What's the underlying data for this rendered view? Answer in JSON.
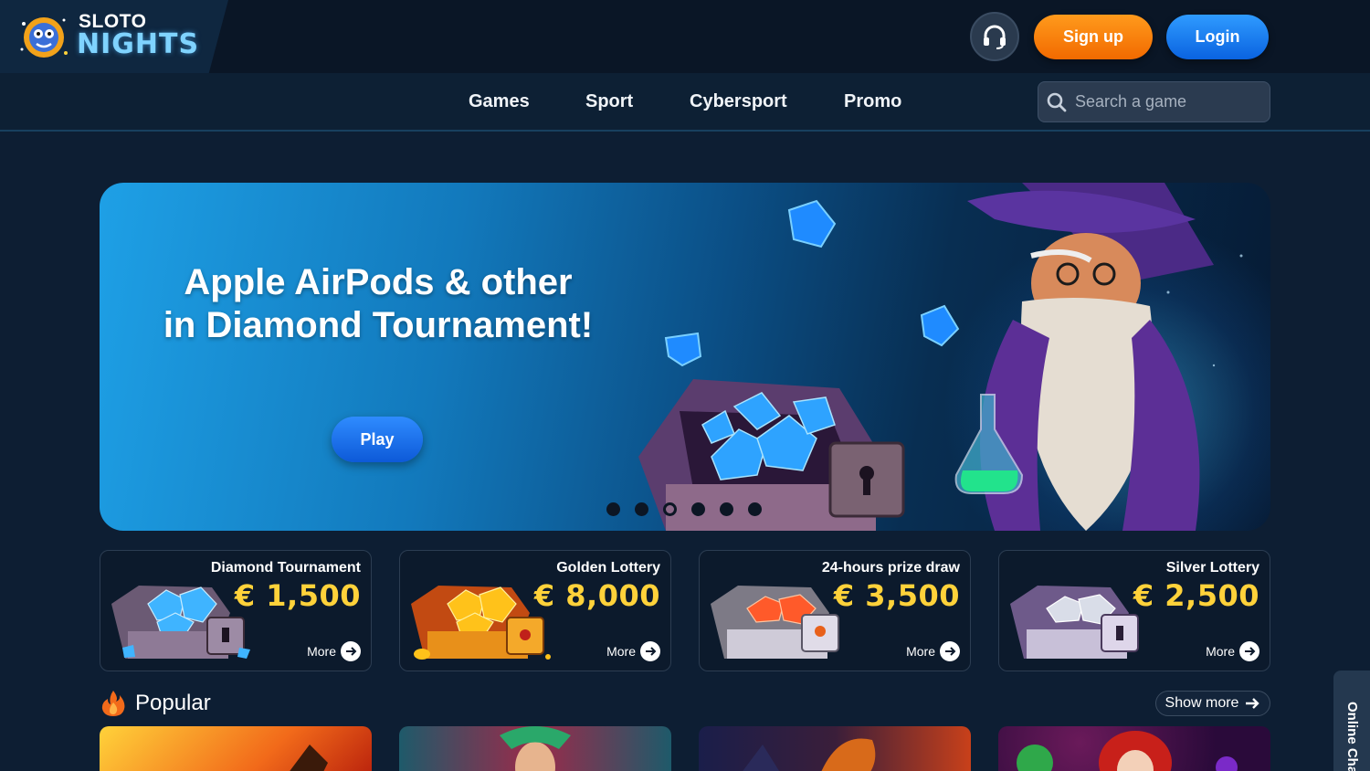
{
  "logo": {
    "line1": "SLOTO",
    "line2": "NIGHTS"
  },
  "header": {
    "signup_label": "Sign up",
    "login_label": "Login"
  },
  "nav": {
    "items": [
      {
        "label": "Games"
      },
      {
        "label": "Sport"
      },
      {
        "label": "Cybersport"
      },
      {
        "label": "Promo"
      }
    ],
    "search_placeholder": "Search a game"
  },
  "banner": {
    "title_line1": "Apple AirPods & other",
    "title_line2": "in Diamond Tournament!",
    "play_label": "Play",
    "slide_count": 6,
    "active_slide": 3
  },
  "promos": [
    {
      "title": "Diamond Tournament",
      "amount": "€ 1,500",
      "more": "More",
      "gem_color": "#3fb4ff"
    },
    {
      "title": "Golden Lottery",
      "amount": "€ 8,000",
      "more": "More",
      "gem_color": "#ffc21a"
    },
    {
      "title": "24-hours prize draw",
      "amount": "€ 3,500",
      "more": "More",
      "gem_color": "#ff5a2a"
    },
    {
      "title": "Silver Lottery",
      "amount": "€ 2,500",
      "more": "More",
      "gem_color": "#d9dde8"
    }
  ],
  "popular": {
    "title": "Popular",
    "show_more": "Show more"
  },
  "online_chat": "Online Chat",
  "colors": {
    "accent_orange": "#f57a0a",
    "accent_blue": "#1877ee",
    "amount_yellow": "#ffd23a",
    "bg": "#0d1e33"
  }
}
